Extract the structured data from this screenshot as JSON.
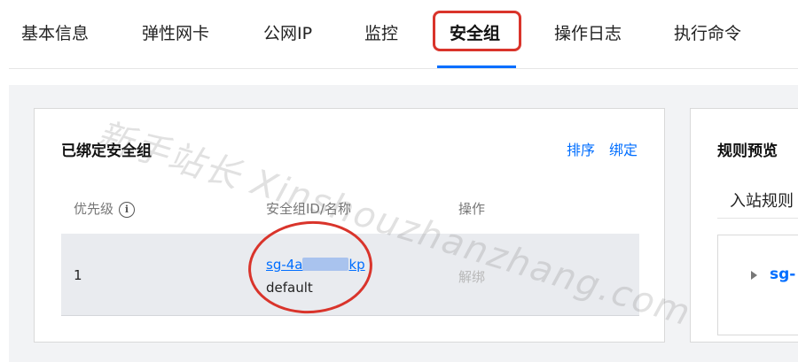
{
  "tabs": [
    {
      "label": "基本信息"
    },
    {
      "label": "弹性网卡"
    },
    {
      "label": "公网IP"
    },
    {
      "label": "监控"
    },
    {
      "label": "安全组"
    },
    {
      "label": "操作日志"
    },
    {
      "label": "执行命令"
    }
  ],
  "active_tab": "安全组",
  "card": {
    "title": "已绑定安全组",
    "sort_label": "排序",
    "bind_label": "绑定",
    "columns": [
      "优先级",
      "安全组ID/名称",
      "操作"
    ],
    "rows": [
      {
        "priority": "1",
        "sg_id_start": "sg-4a",
        "sg_id_end": "kp",
        "sg_name": "default",
        "action": "解绑"
      }
    ]
  },
  "preview": {
    "title": "规则预览",
    "inbound_tab": "入站规则",
    "sg_label": "sg-"
  },
  "watermark": "新手站长 Xinshouzhanzhang.com",
  "colors": {
    "accent": "#006eff",
    "highlight": "#d9342b",
    "disabled_text": "#b8b8b8"
  }
}
